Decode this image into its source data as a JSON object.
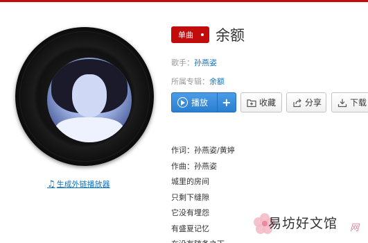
{
  "song": {
    "badge": "单曲",
    "title": "余额",
    "artist_label": "歌手：",
    "artist": "孙燕姿",
    "album_label": "所属专辑：",
    "album": "余额"
  },
  "actions": {
    "play": "播放",
    "add": "+",
    "collect": "收藏",
    "share": "分享",
    "download": "下载"
  },
  "player_link": "生成外链播放器",
  "lyrics": [
    "作词：孙燕姿/黄婷",
    "作曲：孙燕姿",
    "城里的房间",
    "只剩下缝隙",
    "它没有埋怨",
    "有盛夏记忆",
    "在没有随备之下"
  ],
  "watermark": {
    "text": "易坊好文馆",
    "web": "网"
  },
  "colors": {
    "brand_red": "#c20c0c",
    "link_blue": "#0c73c2",
    "play_blue": "#2b7fd0"
  }
}
